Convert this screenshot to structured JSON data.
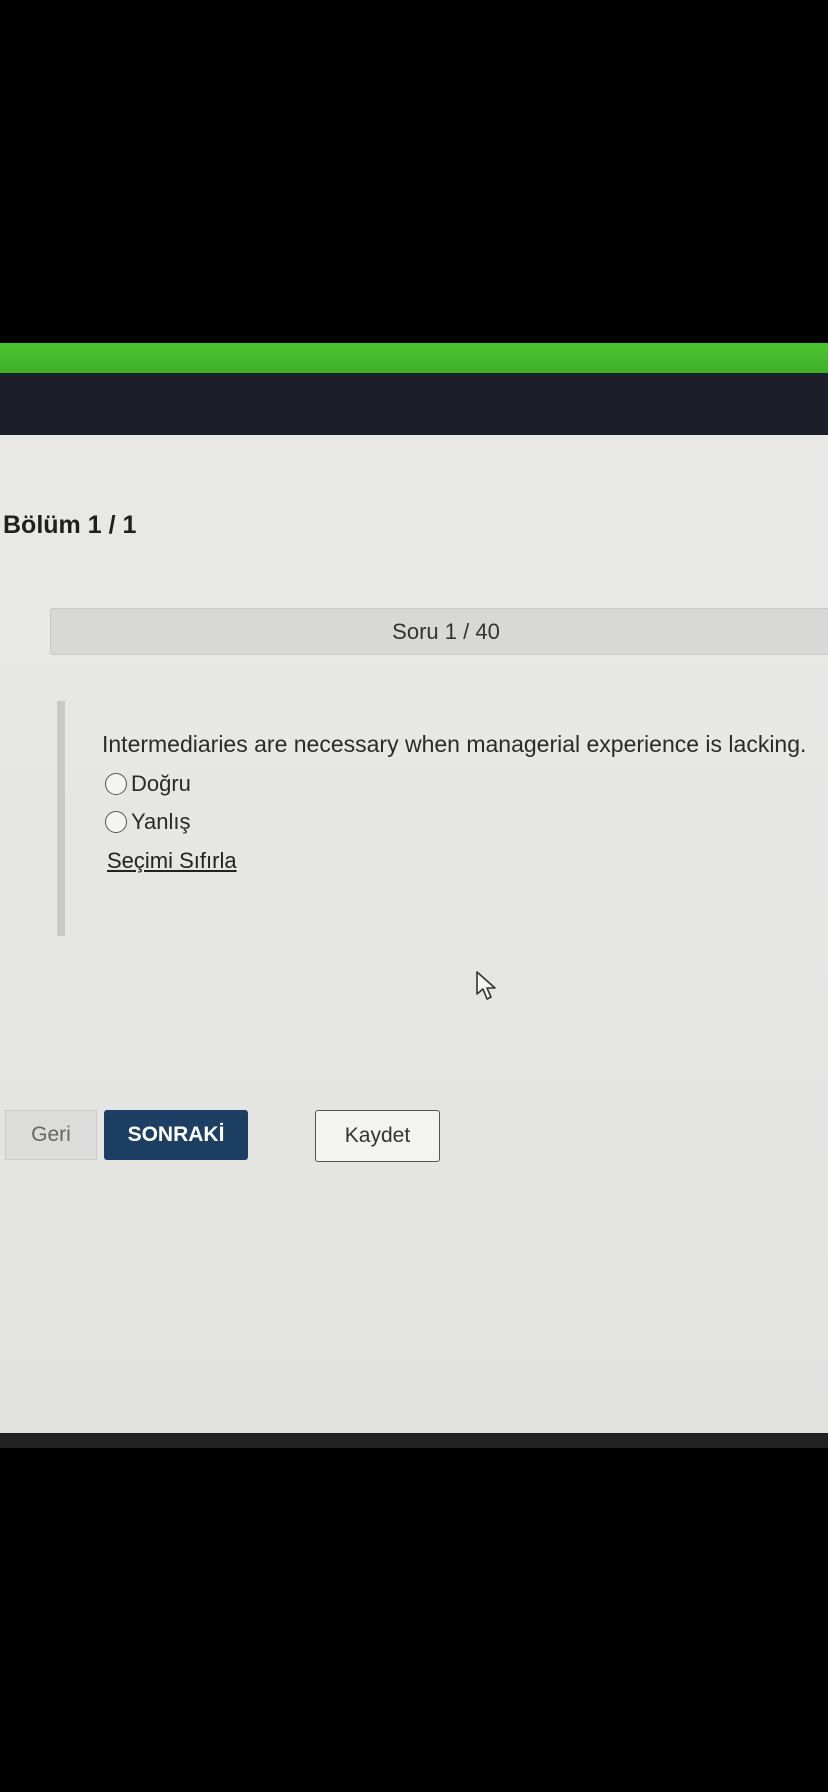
{
  "section": {
    "title": "Bölüm 1 / 1"
  },
  "question": {
    "counter": "Soru 1 / 40",
    "text": "Intermediaries are necessary when managerial experience is lacking.",
    "options": [
      {
        "label": "Doğru",
        "selected": false
      },
      {
        "label": "Yanlış",
        "selected": false
      }
    ],
    "reset_label": "Seçimi Sıfırla"
  },
  "buttons": {
    "back_label": "Geri",
    "next_label": "SONRAKİ",
    "save_label": "Kaydet"
  },
  "colors": {
    "top_bar": "#4cc431",
    "header_band": "#1c1f2a",
    "primary_button": "#1c3f63"
  },
  "icons": [
    "mouse-pointer-icon"
  ]
}
